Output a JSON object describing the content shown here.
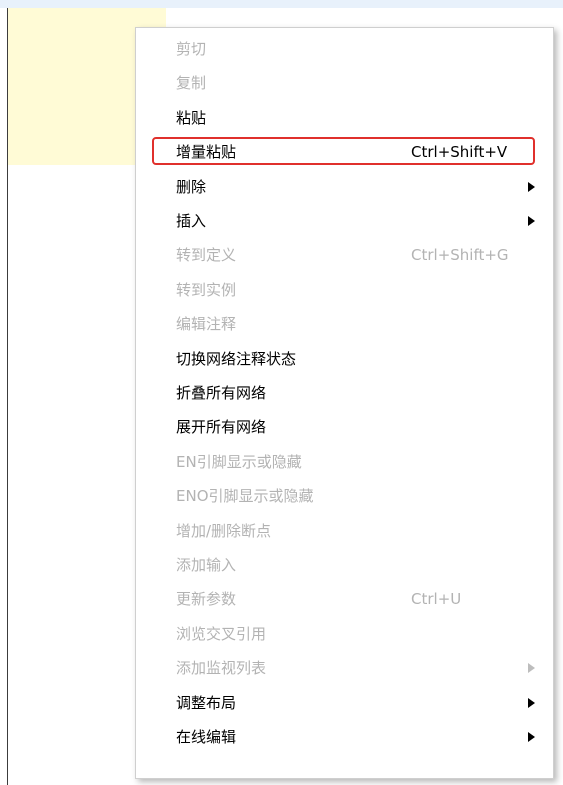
{
  "colors": {
    "highlight_border": "#e0302c",
    "enabled_text": "#000000",
    "disabled_text": "#b3b3b3",
    "background_yellow": "#fffbd6",
    "top_strip": "#e8f1fb"
  },
  "menu": {
    "items": [
      {
        "label": "剪切",
        "shortcut": "",
        "enabled": false,
        "submenu": false,
        "highlighted": false
      },
      {
        "label": "复制",
        "shortcut": "",
        "enabled": false,
        "submenu": false,
        "highlighted": false
      },
      {
        "label": "粘贴",
        "shortcut": "",
        "enabled": true,
        "submenu": false,
        "highlighted": false
      },
      {
        "label": "增量粘贴",
        "shortcut": "Ctrl+Shift+V",
        "enabled": true,
        "submenu": false,
        "highlighted": true
      },
      {
        "label": "删除",
        "shortcut": "",
        "enabled": true,
        "submenu": true,
        "highlighted": false
      },
      {
        "label": "插入",
        "shortcut": "",
        "enabled": true,
        "submenu": true,
        "highlighted": false
      },
      {
        "label": "转到定义",
        "shortcut": "Ctrl+Shift+G",
        "enabled": false,
        "submenu": false,
        "highlighted": false
      },
      {
        "label": "转到实例",
        "shortcut": "",
        "enabled": false,
        "submenu": false,
        "highlighted": false
      },
      {
        "label": "编辑注释",
        "shortcut": "",
        "enabled": false,
        "submenu": false,
        "highlighted": false
      },
      {
        "label": "切换网络注释状态",
        "shortcut": "",
        "enabled": true,
        "submenu": false,
        "highlighted": false
      },
      {
        "label": "折叠所有网络",
        "shortcut": "",
        "enabled": true,
        "submenu": false,
        "highlighted": false
      },
      {
        "label": "展开所有网络",
        "shortcut": "",
        "enabled": true,
        "submenu": false,
        "highlighted": false
      },
      {
        "label": "EN引脚显示或隐藏",
        "shortcut": "",
        "enabled": false,
        "submenu": false,
        "highlighted": false
      },
      {
        "label": "ENO引脚显示或隐藏",
        "shortcut": "",
        "enabled": false,
        "submenu": false,
        "highlighted": false
      },
      {
        "label": "增加/删除断点",
        "shortcut": "",
        "enabled": false,
        "submenu": false,
        "highlighted": false
      },
      {
        "label": "添加输入",
        "shortcut": "",
        "enabled": false,
        "submenu": false,
        "highlighted": false
      },
      {
        "label": "更新参数",
        "shortcut": "Ctrl+U",
        "enabled": false,
        "submenu": false,
        "highlighted": false
      },
      {
        "label": "浏览交叉引用",
        "shortcut": "",
        "enabled": false,
        "submenu": false,
        "highlighted": false
      },
      {
        "label": "添加监视列表",
        "shortcut": "",
        "enabled": false,
        "submenu": true,
        "highlighted": false
      },
      {
        "label": "调整布局",
        "shortcut": "",
        "enabled": true,
        "submenu": true,
        "highlighted": false
      },
      {
        "label": "在线编辑",
        "shortcut": "",
        "enabled": true,
        "submenu": true,
        "highlighted": false
      }
    ]
  }
}
